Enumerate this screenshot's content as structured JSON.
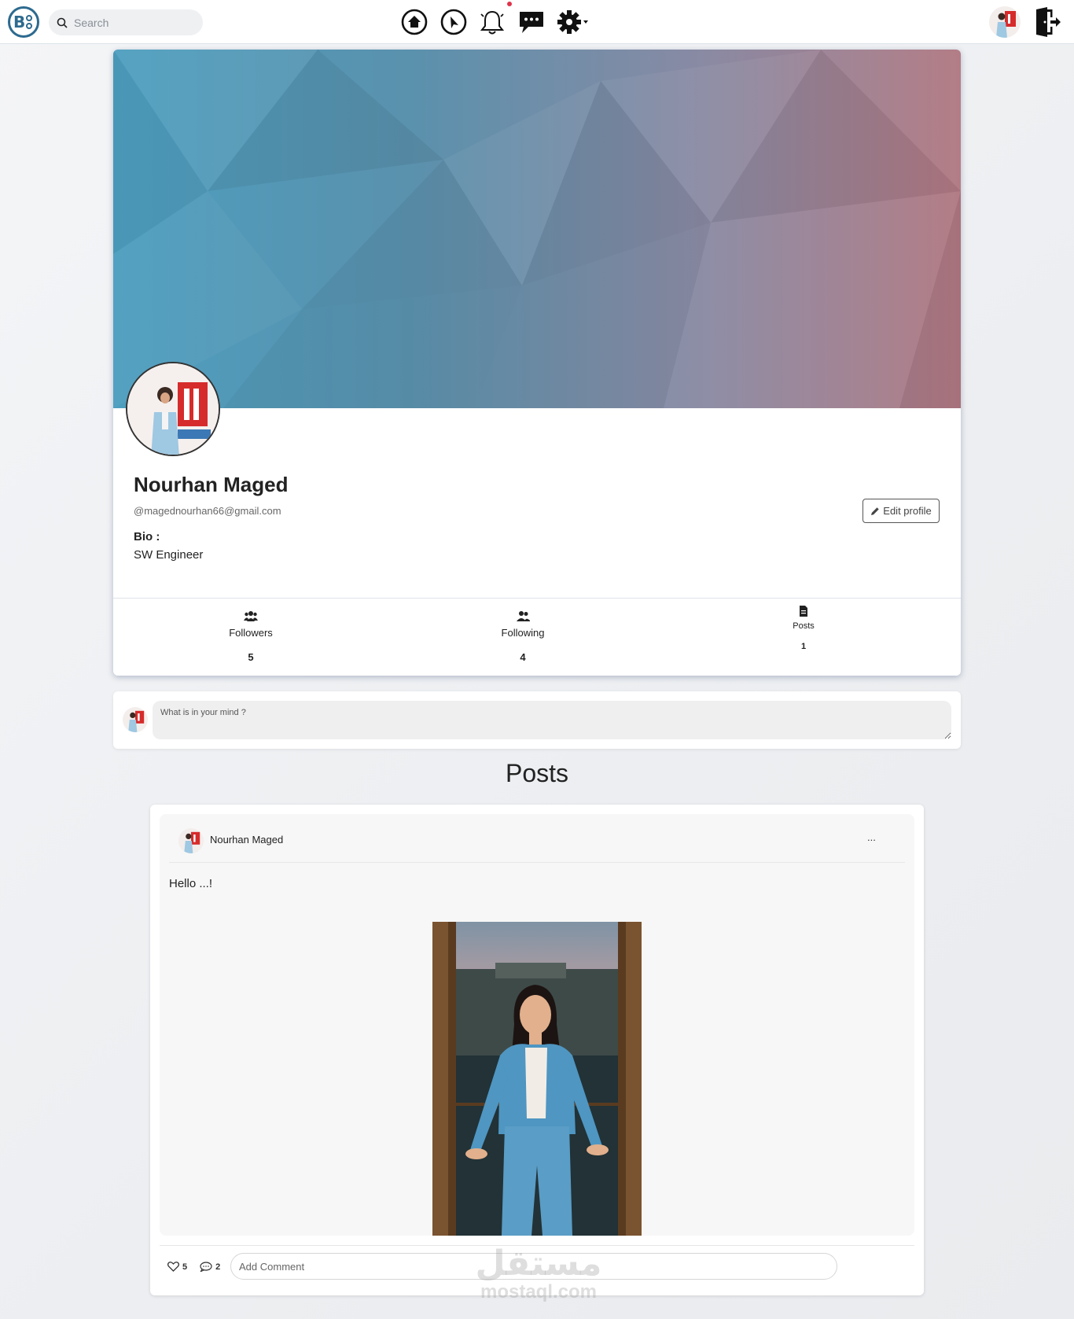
{
  "nav": {
    "search_placeholder": "Search",
    "icons": [
      "logo-icon",
      "search-icon",
      "home-icon",
      "explore-icon",
      "notifications-bell-icon",
      "messages-icon",
      "settings-gear-icon",
      "logout-icon"
    ],
    "notification_dot_color": "#e0334a"
  },
  "profile": {
    "name": "Nourhan Maged",
    "email": "@magednourhan66@gmail.com",
    "bio_label": "Bio :",
    "bio": "SW Engineer",
    "edit_label": "Edit profile",
    "stats": {
      "followers_label": "Followers",
      "followers_count": "5",
      "following_label": "Following",
      "following_count": "4",
      "posts_label": "Posts",
      "posts_count": "1"
    },
    "cover_colors": [
      "#4d9ebf",
      "#b07882"
    ]
  },
  "composer": {
    "placeholder": "What is in your mind ?"
  },
  "posts_heading": "Posts",
  "post": {
    "author": "Nourhan Maged",
    "menu": "...",
    "text": "Hello ...!",
    "likes": "5",
    "comments": "2",
    "comment_placeholder": "Add Comment"
  },
  "watermark": {
    "arabic": "مستقل",
    "latin": "mostaql.com"
  }
}
